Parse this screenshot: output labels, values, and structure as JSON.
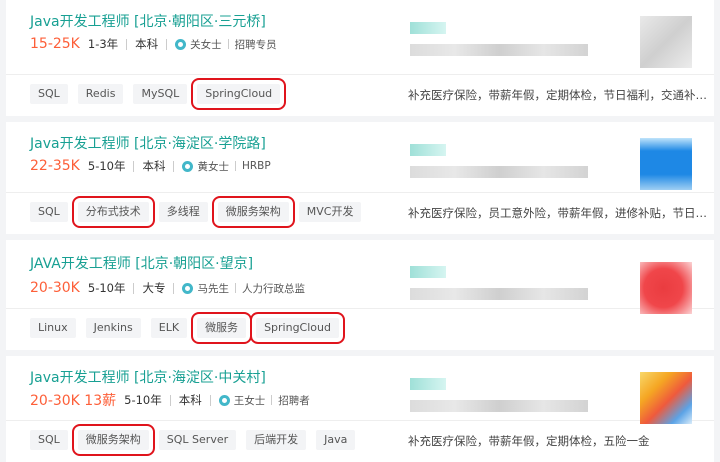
{
  "jobs": [
    {
      "title": "Java开发工程师  [北京·朝阳区·三元桥]",
      "salary": "15-25K",
      "experience": "1-3年",
      "education": "本科",
      "recruiter_name": "关女士",
      "recruiter_role": "招聘专员",
      "tags": [
        "SQL",
        "Redis",
        "MySQL",
        "SpringCloud"
      ],
      "highlighted": [
        false,
        false,
        false,
        true
      ],
      "benefits": "补充医疗保险，带薪年假，定期体检，节日福利，交通补…",
      "logo_color": "#d9d9d9"
    },
    {
      "title": "Java开发工程师  [北京·海淀区·学院路]",
      "salary": "22-35K",
      "experience": "5-10年",
      "education": "本科",
      "recruiter_name": "黄女士",
      "recruiter_role": "HRBP",
      "tags": [
        "SQL",
        "分布式技术",
        "多线程",
        "微服务架构",
        "MVC开发"
      ],
      "highlighted": [
        false,
        true,
        false,
        true,
        false
      ],
      "benefits": "补充医疗保险，员工意外险，带薪年假，进修补贴，节日…",
      "logo_color": "#1e88e5"
    },
    {
      "title": "JAVA开发工程师  [北京·朝阳区·望京]",
      "salary": "20-30K",
      "experience": "5-10年",
      "education": "大专",
      "recruiter_name": "马先生",
      "recruiter_role": "人力行政总监",
      "tags": [
        "Linux",
        "Jenkins",
        "ELK",
        "微服务",
        "SpringCloud"
      ],
      "highlighted": [
        false,
        false,
        false,
        true,
        true
      ],
      "benefits": "",
      "logo_color": "#f0464a"
    },
    {
      "title": "Java开发工程师  [北京·海淀区·中关村]",
      "salary": "20-30K 13薪",
      "experience": "5-10年",
      "education": "本科",
      "recruiter_name": "王女士",
      "recruiter_role": "招聘者",
      "tags": [
        "SQL",
        "微服务架构",
        "SQL Server",
        "后端开发",
        "Java"
      ],
      "highlighted": [
        false,
        true,
        false,
        false,
        false
      ],
      "benefits": "补充医疗保险，带薪年假，定期体检，五险一金",
      "logo_color": "#f5a623"
    }
  ]
}
